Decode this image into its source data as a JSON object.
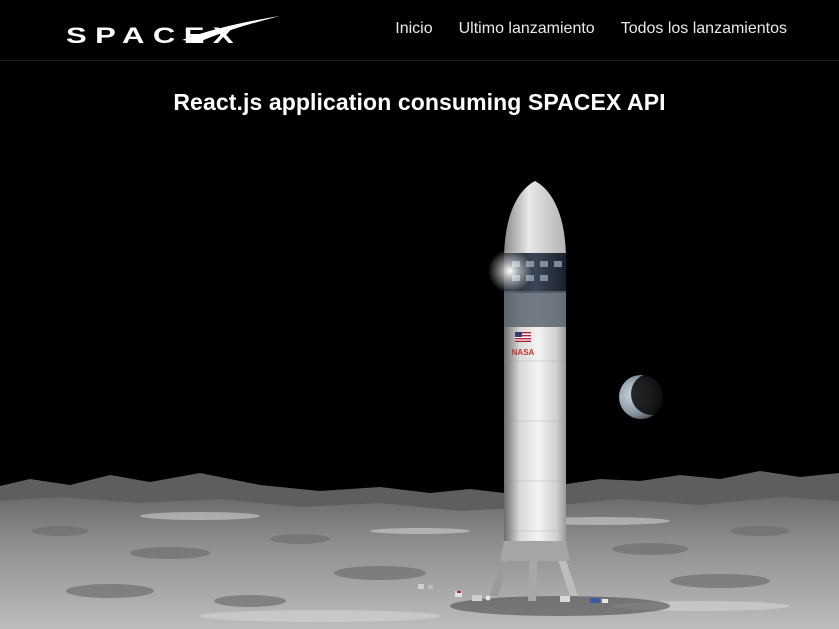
{
  "brand": {
    "logo_text": "SPACEX"
  },
  "nav": {
    "links": [
      {
        "label": "Inicio"
      },
      {
        "label": "Ultimo lanzamiento"
      },
      {
        "label": "Todos los lanzamientos"
      }
    ]
  },
  "hero": {
    "title": "React.js application consuming SPACEX API",
    "rocket_badge_text": "NASA",
    "scene": "starship-on-moon"
  },
  "colors": {
    "background": "#000000",
    "nav_text": "#e9e9e9",
    "title_text": "#ffffff"
  }
}
